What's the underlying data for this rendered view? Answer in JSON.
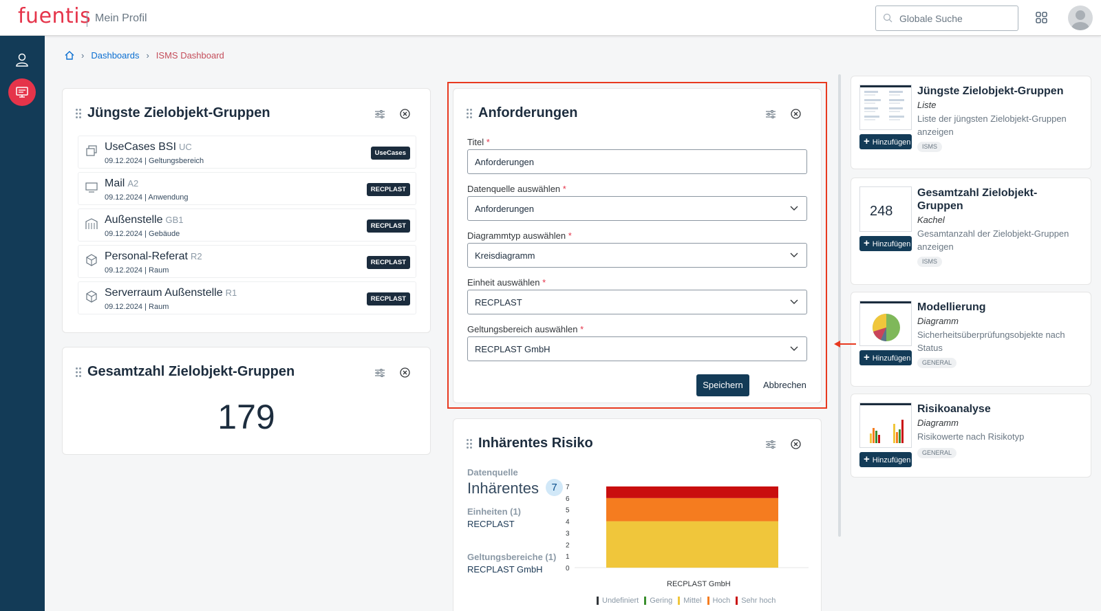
{
  "header": {
    "logo": "fuentis",
    "app_title": "Mein Profil",
    "search_placeholder": "Globale Suche"
  },
  "breadcrumb": {
    "items": [
      "Dashboards",
      "ISMS Dashboard"
    ]
  },
  "widgets": {
    "recent_groups": {
      "title": "Jüngste Zielobjekt-Gruppen",
      "rows": [
        {
          "name": "UseCases BSI",
          "code": "UC",
          "sub": "09.12.2024 | Geltungsbereich",
          "badge": "UseCases",
          "icon": "layers-icon"
        },
        {
          "name": "Mail",
          "code": "A2",
          "sub": "09.12.2024 | Anwendung",
          "badge": "RECPLAST",
          "icon": "monitor-icon"
        },
        {
          "name": "Außenstelle",
          "code": "GB1",
          "sub": "09.12.2024 | Gebäude",
          "badge": "RECPLAST",
          "icon": "building-icon"
        },
        {
          "name": "Personal-Referat",
          "code": "R2",
          "sub": "09.12.2024 | Raum",
          "badge": "RECPLAST",
          "icon": "cube-icon"
        },
        {
          "name": "Serverraum Außenstelle",
          "code": "R1",
          "sub": "09.12.2024 | Raum",
          "badge": "RECPLAST",
          "icon": "cube-icon"
        }
      ]
    },
    "total_groups": {
      "title": "Gesamtzahl Zielobjekt-Gruppen",
      "value": "179"
    },
    "requirements_form": {
      "title": "Anforderungen",
      "fields": [
        {
          "label": "Titel",
          "value": "Anforderungen",
          "type": "text"
        },
        {
          "label": "Datenquelle auswählen",
          "value": "Anforderungen",
          "type": "select"
        },
        {
          "label": "Diagrammtyp auswählen",
          "value": "Kreisdiagramm",
          "type": "select"
        },
        {
          "label": "Einheit auswählen",
          "value": "RECPLAST",
          "type": "select"
        },
        {
          "label": "Geltungsbereich auswählen",
          "value": "RECPLAST GmbH",
          "type": "select"
        }
      ],
      "save_label": "Speichern",
      "cancel_label": "Abbrechen",
      "required_mark": "*"
    },
    "inherent_risk": {
      "title": "Inhärentes Risiko",
      "datasource_label": "Datenquelle",
      "datasource_value": "Inhärentes",
      "datasource_count": "7",
      "units_label": "Einheiten (1)",
      "units_value": "RECPLAST",
      "scopes_label": "Geltungsbereiche (1)",
      "scopes_value": "RECPLAST GmbH"
    }
  },
  "chart_data": {
    "type": "bar",
    "stacked": true,
    "categories": [
      "RECPLAST GmbH"
    ],
    "series": [
      {
        "name": "Undefiniert",
        "values": [
          0
        ],
        "color": "#32363a"
      },
      {
        "name": "Gering",
        "values": [
          0
        ],
        "color": "#3a8f2e"
      },
      {
        "name": "Mittel",
        "values": [
          4
        ],
        "color": "#f0c63b"
      },
      {
        "name": "Hoch",
        "values": [
          2
        ],
        "color": "#f57c1f"
      },
      {
        "name": "Sehr hoch",
        "values": [
          1
        ],
        "color": "#c90e0e"
      }
    ],
    "yticks": [
      "7",
      "6",
      "5",
      "4",
      "3",
      "2",
      "1",
      "0"
    ],
    "ylim": [
      0,
      7
    ],
    "legend_position": "bottom",
    "grid": false
  },
  "palette": {
    "add_label": "Hinzufügen",
    "items": [
      {
        "title": "Jüngste Zielobjekt-Gruppen",
        "type": "Liste",
        "desc": "Liste der jüngsten Zielobjekt-Gruppen anzeigen",
        "tag": "ISMS"
      },
      {
        "title": "Gesamtzahl Zielobjekt-Gruppen",
        "type": "Kachel",
        "desc": "Gesamtanzahl der Zielobjekt-Gruppen anzeigen",
        "tag": "ISMS",
        "thumb_value": "248"
      },
      {
        "title": "Modellierung",
        "type": "Diagramm",
        "desc": "Sicherheitsüberprüfungsobjekte nach Status",
        "tag": "GENERAL"
      },
      {
        "title": "Risikoanalyse",
        "type": "Diagramm",
        "desc": "Risikowerte nach Risikotyp",
        "tag": "GENERAL"
      }
    ]
  },
  "colors": {
    "brand": "#e5344a",
    "rail": "#133b57",
    "primary_button": "#133b57",
    "highlight": "#e8391f"
  }
}
